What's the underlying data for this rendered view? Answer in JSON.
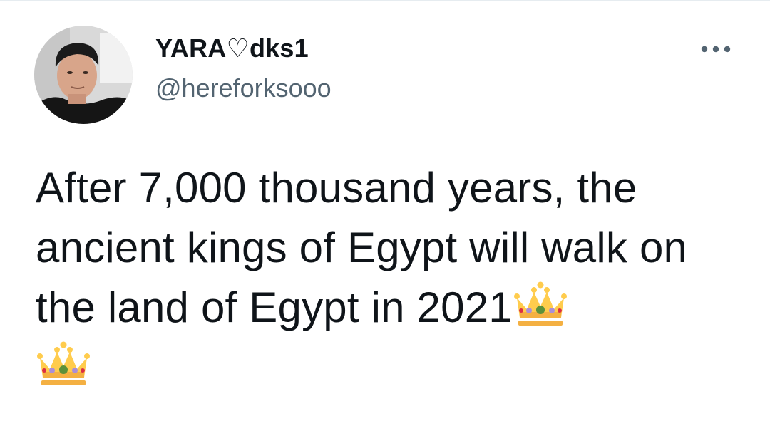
{
  "tweet": {
    "author": {
      "display_name": "YARA♡dks1",
      "handle": "@hereforksooo"
    },
    "text": "After 7,000 thousand years, the ancient kings of Egypt will walk on the land of Egypt in 2021",
    "emoji": [
      "crown-icon",
      "crown-icon"
    ],
    "more_icon": "more-options-icon"
  }
}
